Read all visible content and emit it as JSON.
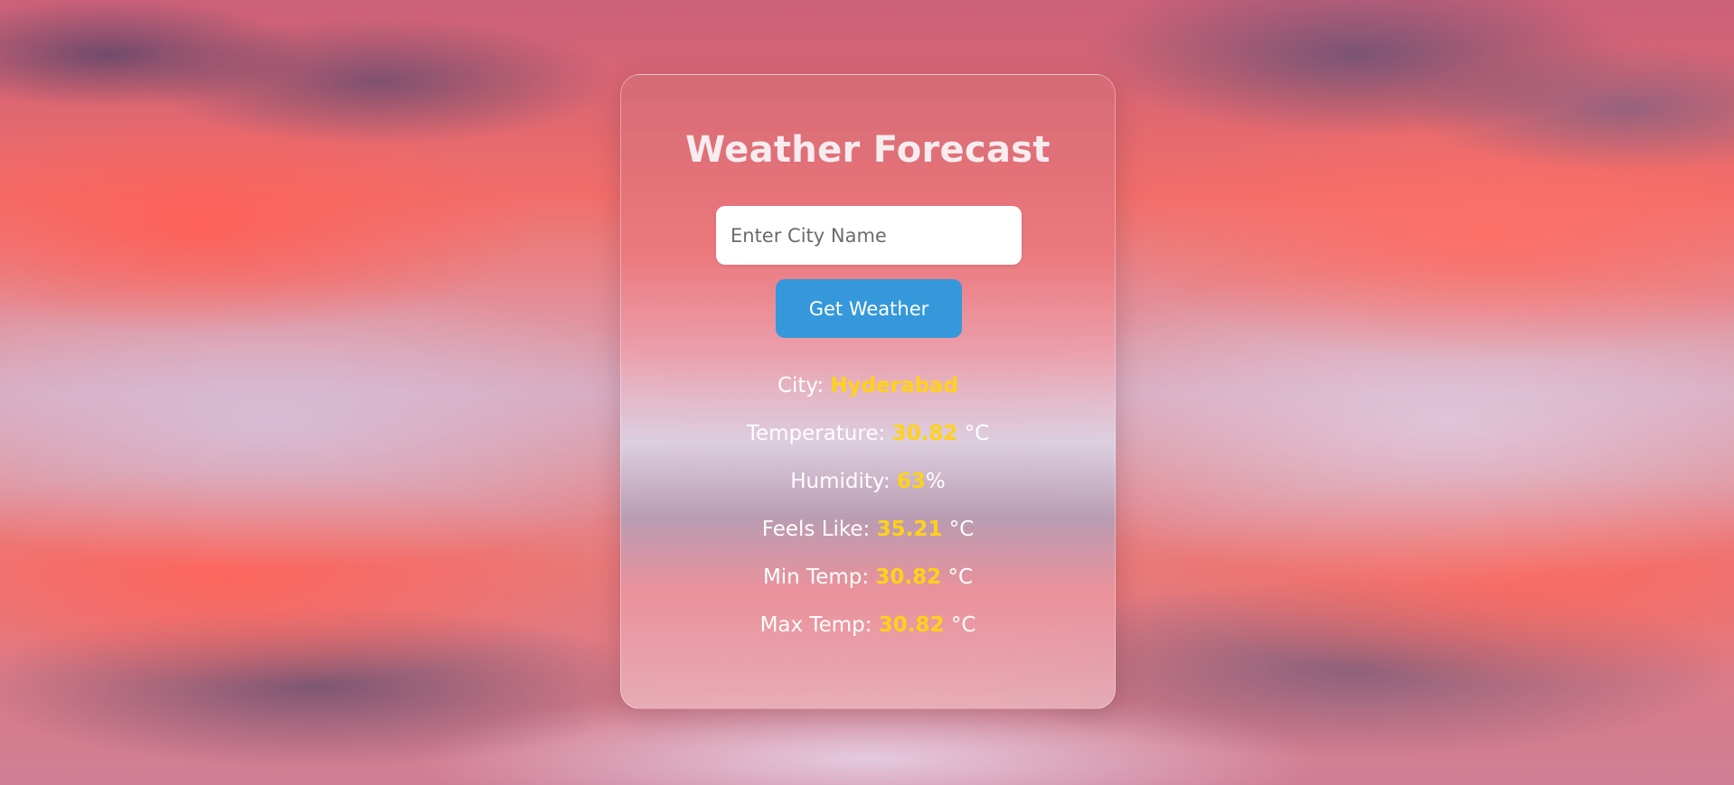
{
  "app": {
    "title": "Weather Forecast"
  },
  "search": {
    "placeholder": "Enter City Name",
    "value": "",
    "button_label": "Get Weather"
  },
  "weather": {
    "city_label": "City:",
    "city": "Hyderabad",
    "temperature_label": "Temperature:",
    "temperature": "30.82",
    "temperature_unit": "°C",
    "humidity_label": "Humidity:",
    "humidity": "63",
    "humidity_unit": "%",
    "feels_like_label": "Feels Like:",
    "feels_like": "35.21",
    "feels_like_unit": "°C",
    "min_temp_label": "Min Temp:",
    "min_temp": "30.82",
    "min_temp_unit": "°C",
    "max_temp_label": "Max Temp:",
    "max_temp": "30.82",
    "max_temp_unit": "°C"
  },
  "colors": {
    "button": "#3498db",
    "value_highlight": "#ffd21a",
    "text": "#ffffff"
  }
}
